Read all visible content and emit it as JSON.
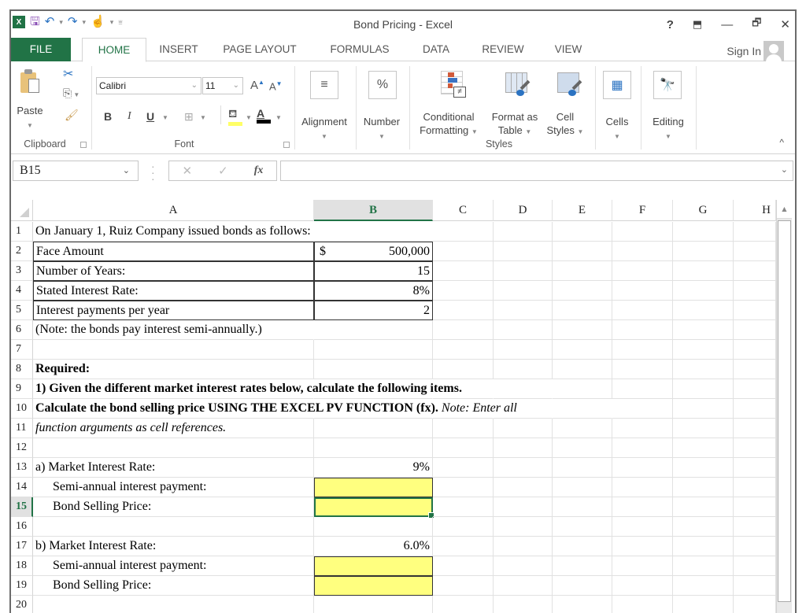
{
  "window": {
    "title": "Bond Pricing - Excel",
    "controls": {
      "help": "?",
      "ribbon_display": "⬒",
      "minimize": "—",
      "restore": "🗗",
      "close": "✕"
    }
  },
  "qat": {
    "logo": "X",
    "save_icon": "🖫",
    "undo_icon": "↶",
    "redo_icon": "↷",
    "touch_icon": "☝",
    "dropdown": "▾",
    "customize": "⩸"
  },
  "tabs": [
    "FILE",
    "HOME",
    "INSERT",
    "PAGE LAYOUT",
    "FORMULAS",
    "DATA",
    "REVIEW",
    "VIEW"
  ],
  "active_tab": "HOME",
  "account": {
    "sign_in": "Sign In"
  },
  "ribbon": {
    "clipboard": {
      "paste": "Paste",
      "label": "Clipboard"
    },
    "font": {
      "name": "Calibri",
      "size": "11",
      "label": "Font",
      "bold": "B",
      "italic": "I",
      "underline": "U",
      "grow": "A",
      "shrink": "A",
      "font_color": "A"
    },
    "alignment": {
      "label": "Alignment"
    },
    "number": {
      "label": "Number",
      "icon": "%"
    },
    "styles": {
      "conditional_1": "Conditional",
      "conditional_2": "Formatting",
      "format_table_1": "Format as",
      "format_table_2": "Table",
      "cell_styles_1": "Cell",
      "cell_styles_2": "Styles",
      "label": "Styles"
    },
    "cells": {
      "label": "Cells"
    },
    "editing": {
      "label": "Editing"
    },
    "collapse": "^"
  },
  "formula_bar": {
    "name_box": "B15",
    "cancel": "✕",
    "enter": "✓",
    "fx": "fx",
    "value": ""
  },
  "columns": [
    "A",
    "B",
    "C",
    "D",
    "E",
    "F",
    "G",
    "H"
  ],
  "selected_column": "B",
  "selected_row": 15,
  "rows": [
    "1",
    "2",
    "3",
    "4",
    "5",
    "6",
    "7",
    "8",
    "9",
    "10",
    "11",
    "12",
    "13",
    "14",
    "15",
    "16",
    "17",
    "18",
    "19",
    "20"
  ],
  "sheet": {
    "r1": "On January 1,  Ruiz Company issued bonds as follows:",
    "r2": {
      "label": "Face Amount",
      "currency": "$",
      "value": "500,000"
    },
    "r3": {
      "label": "Number of Years:",
      "value": "15"
    },
    "r4": {
      "label": "Stated Interest Rate:",
      "value": "8%"
    },
    "r5": {
      "label": "Interest payments per year",
      "value": "2"
    },
    "r6": "(Note: the bonds pay interest semi-annually.)",
    "r8": "Required:",
    "r9": " 1) Given the different market interest rates below, calculate the following items.",
    "r10_bold": "Calculate the bond selling price USING THE EXCEL PV FUNCTION (fx).",
    "r10_italic": " Note: Enter all",
    "r11": "function arguments as cell references.",
    "r13": {
      "label": "a)  Market Interest Rate:",
      "value": "9%"
    },
    "r14": {
      "label": "Semi-annual interest payment:",
      "value": ""
    },
    "r15": {
      "label": "Bond Selling Price:",
      "value": ""
    },
    "r17": {
      "label": "b)  Market Interest Rate:",
      "value": "6.0%"
    },
    "r18": {
      "label": "Semi-annual interest payment:",
      "value": ""
    },
    "r19": {
      "label": "Bond Selling Price:",
      "value": ""
    }
  },
  "colors": {
    "excel_green": "#217346",
    "input_yellow": "#ffff7f"
  }
}
